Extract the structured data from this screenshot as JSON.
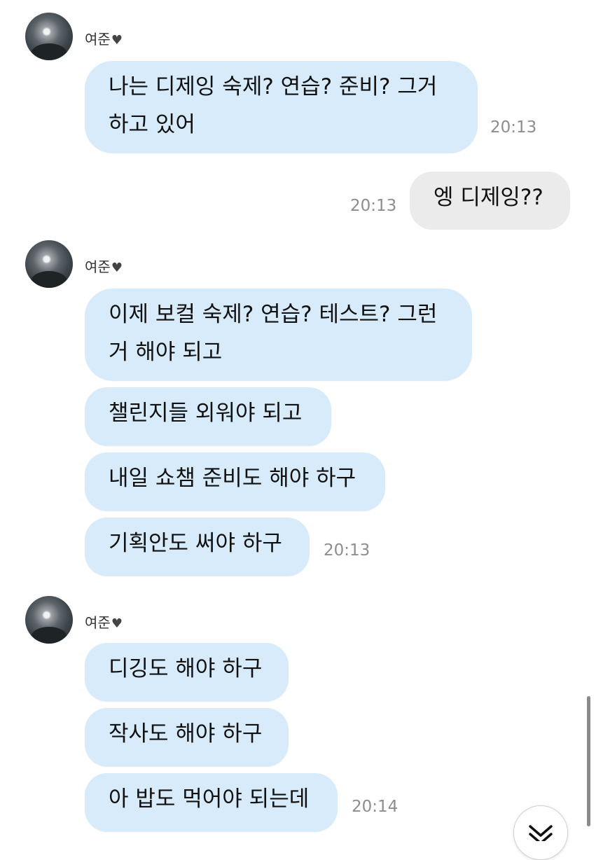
{
  "chat": {
    "sender_name": "여준",
    "sender_heart": "♥",
    "groups": [
      {
        "messages": [
          "나는 디제잉 숙제? 연습? 준비? 그거 하고 있어"
        ],
        "time": "20:13"
      },
      {
        "mine": true,
        "messages": [
          "엥 디제잉??"
        ],
        "time": "20:13"
      },
      {
        "messages": [
          "이제 보컬 숙제? 연습? 테스트? 그런 거 해야 되고",
          "챌린지들 외워야 되고",
          "내일 쇼챔 준비도 해야 하구",
          "기획안도 써야 하구"
        ],
        "time": "20:13"
      },
      {
        "messages": [
          "디깅도 해야 하구",
          "작사도 해야 하구",
          "아 밥도 먹어야 되는데"
        ],
        "time": "20:14"
      }
    ]
  },
  "icons": {
    "avatar": "profile-photo",
    "scroll_down": "chevron-down-icon"
  },
  "colors": {
    "incoming_bubble": "#d7ebfb",
    "outgoing_bubble": "#ebebeb",
    "timestamp": "#8e8e8e"
  }
}
